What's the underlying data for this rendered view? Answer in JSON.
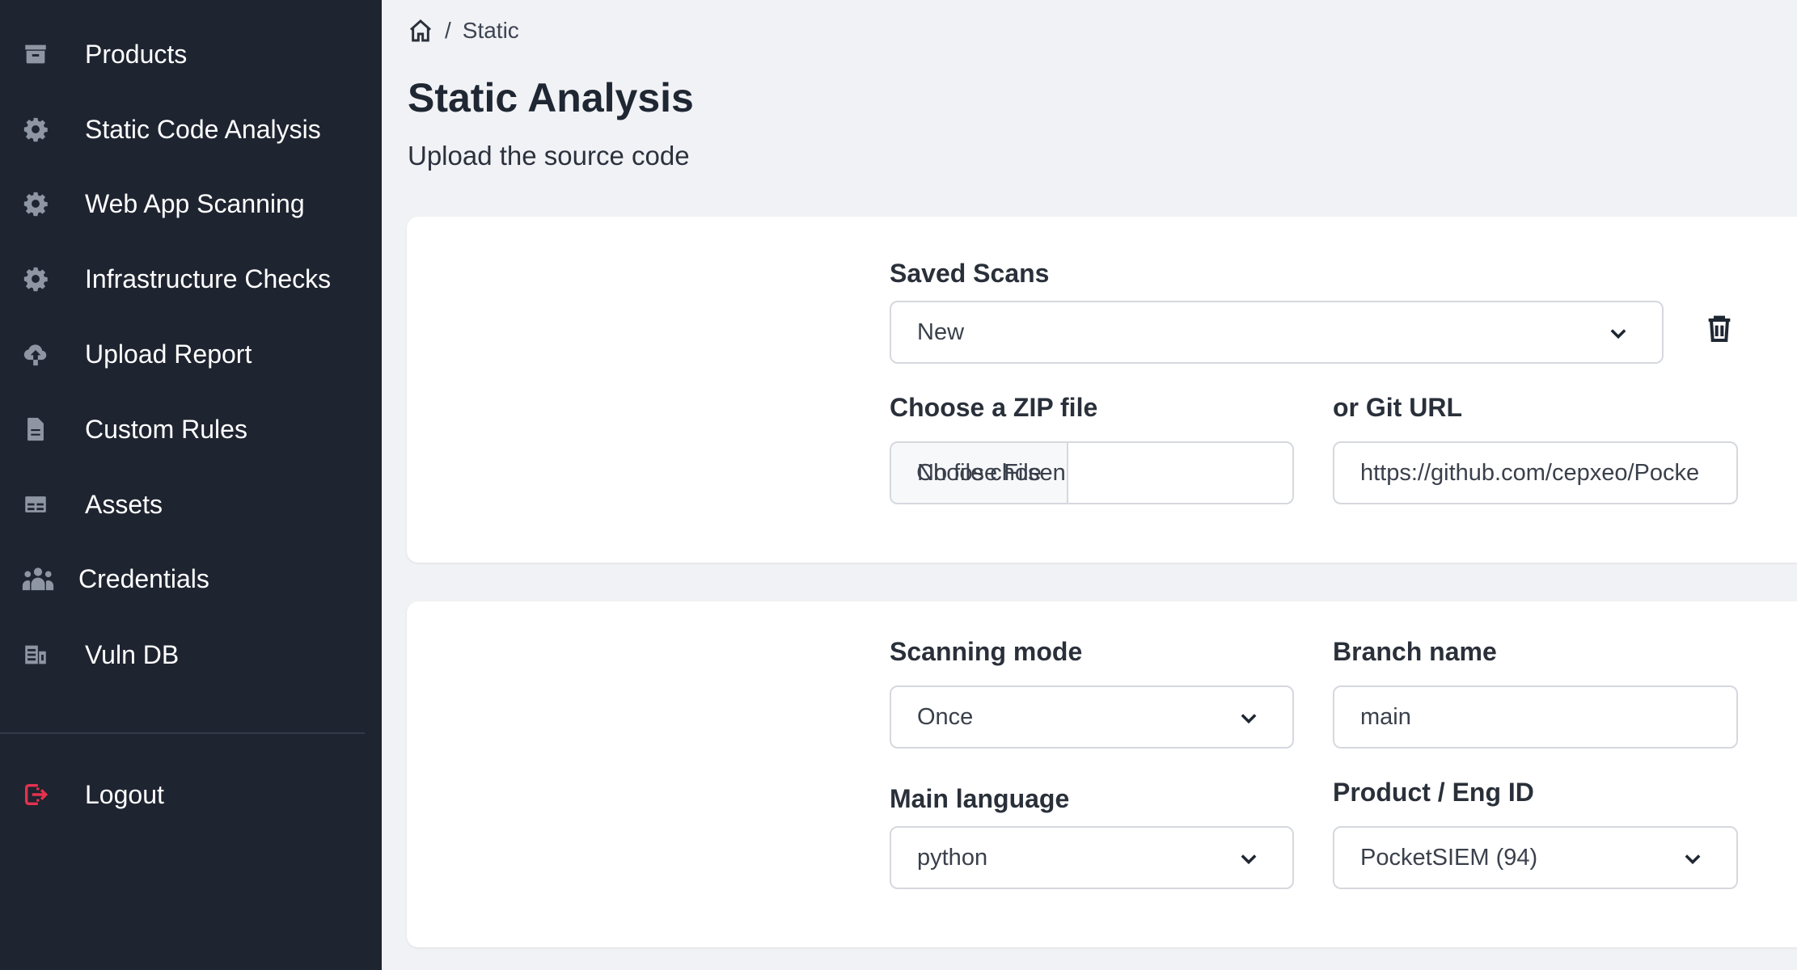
{
  "sidebar": {
    "items": [
      {
        "label": "Products",
        "icon": "archive-icon"
      },
      {
        "label": "Static Code Analysis",
        "icon": "gear-icon"
      },
      {
        "label": "Web App Scanning",
        "icon": "gear-icon"
      },
      {
        "label": "Infrastructure Checks",
        "icon": "gear-icon"
      },
      {
        "label": "Upload Report",
        "icon": "cloud-upload-icon"
      },
      {
        "label": "Custom Rules",
        "icon": "document-icon"
      },
      {
        "label": "Assets",
        "icon": "table-icon"
      },
      {
        "label": "Credentials",
        "icon": "users-icon"
      },
      {
        "label": "Vuln DB",
        "icon": "database-icon"
      }
    ],
    "logout": {
      "label": "Logout",
      "icon": "logout-icon",
      "color": "#e5324f"
    }
  },
  "breadcrumb": {
    "separator": "/",
    "current": "Static"
  },
  "page": {
    "title": "Static Analysis",
    "subtitle": "Upload the source code"
  },
  "form": {
    "saved_scans": {
      "label": "Saved Scans",
      "value": "New"
    },
    "zip": {
      "label": "Choose a ZIP file",
      "button": "Choose File",
      "status": "No file chosen"
    },
    "git": {
      "label": "or Git URL",
      "value": "https://github.com/cepxeo/Pocke"
    },
    "scanning_mode": {
      "label": "Scanning mode",
      "value": "Once"
    },
    "branch": {
      "label": "Branch name",
      "value": "main"
    },
    "language": {
      "label": "Main language",
      "value": "python"
    },
    "product": {
      "label": "Product / Eng ID",
      "value": "PocketSIEM (94)"
    }
  },
  "colors": {
    "sidebar_bg": "#1e2430",
    "page_bg": "#f1f2f5",
    "accent_logout": "#e5324f"
  }
}
